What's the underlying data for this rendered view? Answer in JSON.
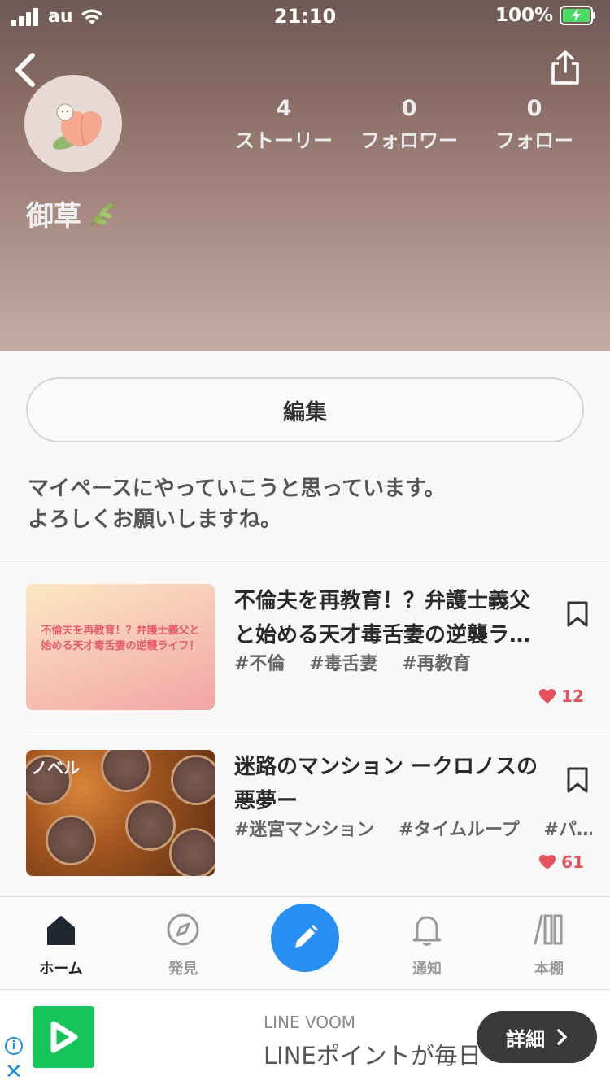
{
  "status_bar": {
    "carrier": "au",
    "time": "21:10",
    "battery": "100%"
  },
  "profile": {
    "username": "御草",
    "stats": [
      {
        "value": "4",
        "label": "ストーリー"
      },
      {
        "value": "0",
        "label": "フォロワー"
      },
      {
        "value": "0",
        "label": "フォロー"
      }
    ],
    "edit_label": "編集",
    "bio_line1": "マイペースにやっていこうと思っています。",
    "bio_line2": "よろしくお願いしますね。"
  },
  "stories": [
    {
      "title": "不倫夫を再教育！？弁護士義父と始める天才毒舌妻の逆襲ラ…",
      "thumb_text": "不倫夫を再教育！？弁護士義父と始める天才毒舌妻の逆襲ライフ！",
      "tags": [
        "#不倫",
        "#毒舌妻",
        "#再教育"
      ],
      "likes": "12"
    },
    {
      "title": "迷路のマンション ークロノスの悪夢ー",
      "thumb_badge": "ノベル",
      "tags": [
        "#迷宮マンション",
        "#タイムループ",
        "#パ…"
      ],
      "likes": "61"
    }
  ],
  "tabbar": {
    "home": "ホーム",
    "discover": "発見",
    "notifications": "通知",
    "bookshelf": "本棚"
  },
  "ad": {
    "sponsor": "LINE VOOM",
    "text": "LINEポイントが毎日",
    "cta": "詳細"
  },
  "colors": {
    "accent": "#2790f2",
    "like": "#e5525e",
    "line_green": "#16c45a"
  }
}
